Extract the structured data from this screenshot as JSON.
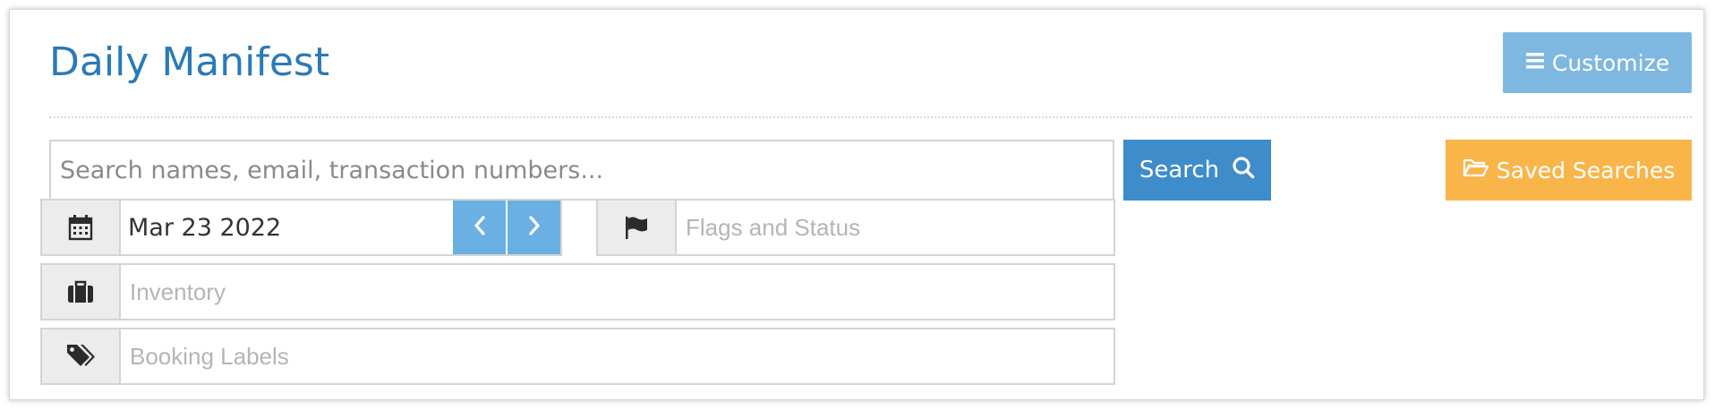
{
  "page": {
    "title": "Daily Manifest"
  },
  "toolbar": {
    "customize_label": "Customize",
    "customize_icon": "list-icon"
  },
  "search": {
    "placeholder": "Search names, email, transaction numbers...",
    "value": "",
    "button_label": "Search",
    "button_icon": "search-icon"
  },
  "saved_searches": {
    "label": "Saved Searches",
    "icon": "folder-open-icon"
  },
  "filters": {
    "date": {
      "icon": "calendar-icon",
      "value": "Mar 23 2022",
      "prev_icon": "chevron-left-icon",
      "next_icon": "chevron-right-icon"
    },
    "flags": {
      "icon": "flag-icon",
      "placeholder": "Flags and Status"
    },
    "inventory": {
      "icon": "briefcase-icon",
      "placeholder": "Inventory"
    },
    "booking_labels": {
      "icon": "tags-icon",
      "placeholder": "Booking Labels"
    }
  },
  "colors": {
    "title": "#2a7ab8",
    "customize_button": "#7eb8e0",
    "search_button": "#3f8ccb",
    "saved_searches_button": "#f9b54a",
    "date_nav_button": "#6bb0e3",
    "addon_background": "#ececec",
    "border": "#d4d4d4"
  }
}
